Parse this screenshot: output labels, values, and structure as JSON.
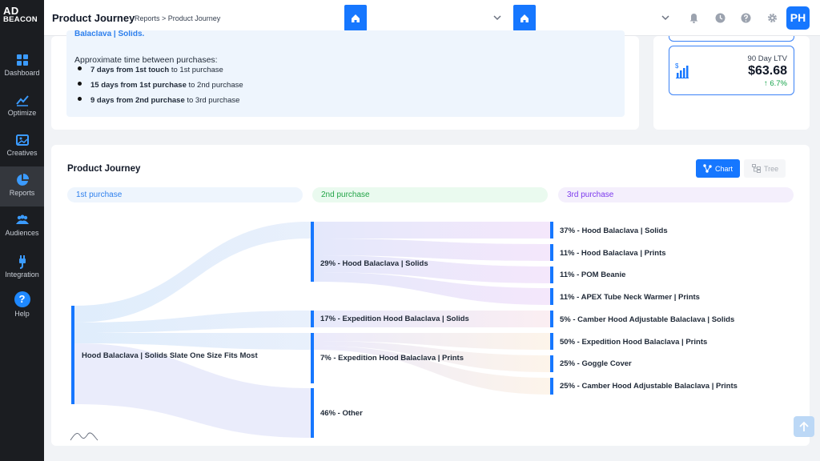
{
  "sidebar": {
    "logo_line1": "AD",
    "logo_line2": "BEACON",
    "items": [
      {
        "label": "Dashboard"
      },
      {
        "label": "Optimize"
      },
      {
        "label": "Creatives"
      },
      {
        "label": "Reports"
      },
      {
        "label": "Audiences"
      },
      {
        "label": "Integration"
      },
      {
        "label": "Help"
      }
    ],
    "help_glyph": "?"
  },
  "header": {
    "title": "Product Journey",
    "breadcrumb": "Reports > Product Journey",
    "avatar": "PH"
  },
  "summary": {
    "cut_text": "Balaclava | Solids.",
    "approx_title": "Approximate time between purchases:",
    "bullets": [
      {
        "bold": "7 days from 1st touch",
        "rest": " to 1st purchase"
      },
      {
        "bold": "15 days from 1st purchase",
        "rest": " to 2nd purchase"
      },
      {
        "bold": "9 days from 2nd purchase",
        "rest": " to 3rd purchase"
      }
    ]
  },
  "ltv": {
    "label": "90 Day LTV",
    "value": "$63.68",
    "change": "↑ 6.7%",
    "change_color": "#16a34a"
  },
  "journey": {
    "title": "Product Journey",
    "chart_button": "Chart",
    "tree_button": "Tree",
    "stages": [
      "1st purchase",
      "2nd purchase",
      "3rd purchase"
    ],
    "first": "Hood Balaclava | Solids Slate One Size Fits Most",
    "second": [
      "29% - Hood Balaclava | Solids",
      "17% - Expedition Hood Balaclava | Solids",
      "7% - Expedition Hood Balaclava | Prints",
      "46% - Other"
    ],
    "third": [
      "37% -  Hood Balaclava | Solids",
      "11% -  Hood Balaclava | Prints",
      "11% -  POM Beanie",
      "11% -  APEX Tube Neck Warmer | Prints",
      "5% -  Camber Hood Adjustable Balaclava | Solids",
      "50% -  Expedition Hood Balaclava | Prints",
      "25% -  Goggle Cover",
      "25% -  Camber Hood Adjustable Balaclava | Prints"
    ],
    "accent": "#1677ff"
  }
}
